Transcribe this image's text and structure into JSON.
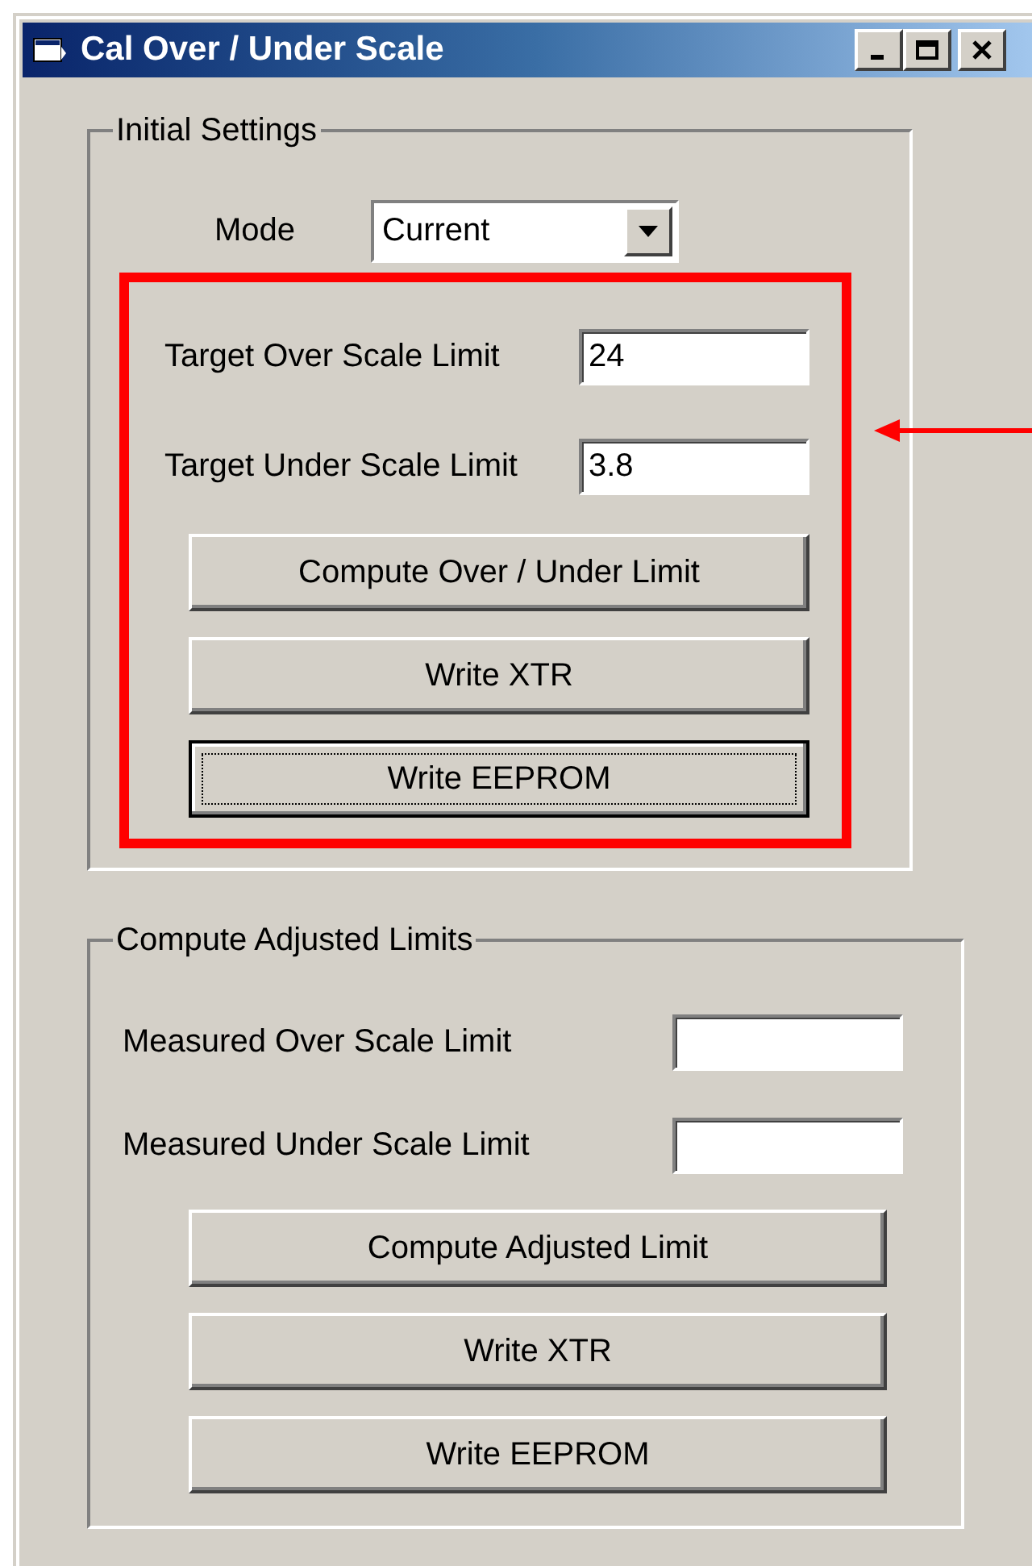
{
  "window": {
    "title": "Cal Over / Under Scale"
  },
  "groups": [
    {
      "title": "Initial Settings",
      "mode": {
        "label": "Mode",
        "value": "Current"
      },
      "highlighted": true,
      "fields": [
        {
          "label": "Target Over Scale Limit",
          "value": "24"
        },
        {
          "label": "Target Under Scale Limit",
          "value": "3.8"
        }
      ],
      "buttons": [
        {
          "label": "Compute Over / Under Limit",
          "focused": false
        },
        {
          "label": "Write XTR",
          "focused": false
        },
        {
          "label": "Write EEPROM",
          "focused": true
        }
      ]
    },
    {
      "title": "Compute Adjusted Limits",
      "highlighted": false,
      "fields": [
        {
          "label": "Measured Over Scale Limit"
        },
        {
          "label": "Measured Under Scale Limit"
        }
      ],
      "buttons": [
        {
          "label": "Compute Adjusted Limit",
          "focused": false
        },
        {
          "label": "Write XTR",
          "focused": false
        },
        {
          "label": "Write EEPROM",
          "focused": false
        }
      ]
    }
  ]
}
